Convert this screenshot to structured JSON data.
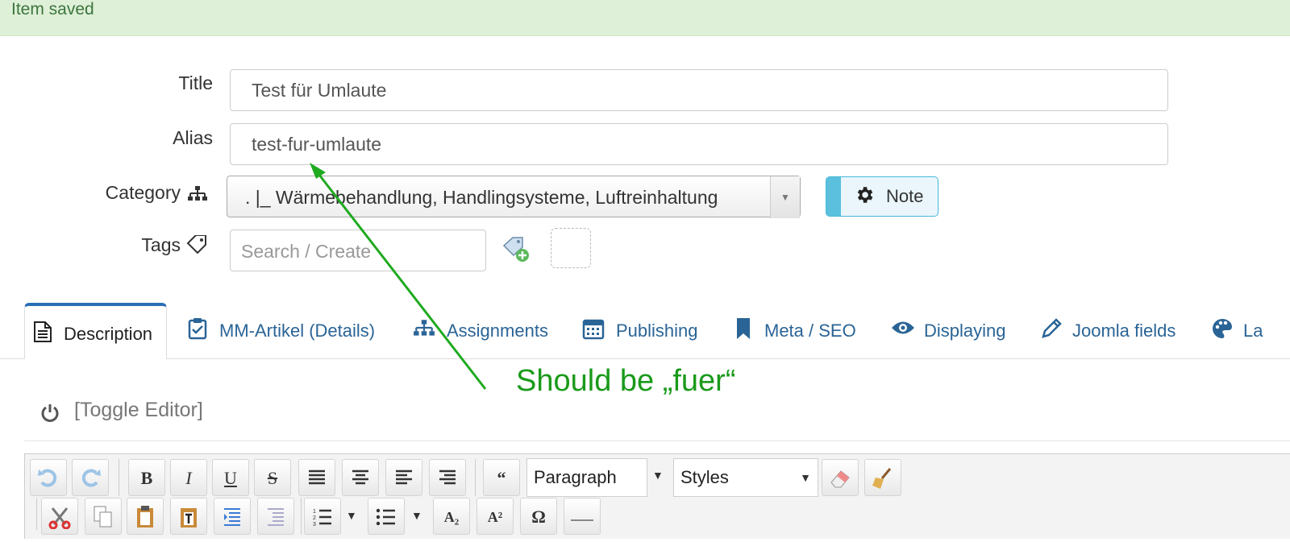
{
  "alert": {
    "message": "Item saved"
  },
  "form": {
    "title_label": "Title",
    "title_value": "Test für Umlaute",
    "alias_label": "Alias",
    "alias_value": "test-fur-umlaute",
    "category_label": "Category",
    "category_value": ". |_ Wärmebehandlung, Handlingsysteme, Luftreinhaltung",
    "note_label": "Note",
    "tags_label": "Tags",
    "tags_placeholder": "Search / Create"
  },
  "tabs": [
    {
      "label": "Description",
      "icon": "document-icon",
      "active": true
    },
    {
      "label": "MM-Artikel (Details)",
      "icon": "clipboard-check-icon"
    },
    {
      "label": "Assignments",
      "icon": "sitemap-icon"
    },
    {
      "label": "Publishing",
      "icon": "calendar-icon"
    },
    {
      "label": "Meta / SEO",
      "icon": "bookmark-icon"
    },
    {
      "label": "Displaying",
      "icon": "eye-icon"
    },
    {
      "label": "Joomla fields",
      "icon": "pencil-icon"
    },
    {
      "label": "La",
      "icon": "palette-icon"
    }
  ],
  "editor": {
    "toggle_label": "[Toggle Editor]",
    "format_select": "Paragraph",
    "styles_select": "Styles",
    "btn_bold": "B",
    "btn_italic": "I",
    "btn_underline": "U",
    "btn_strike": "S",
    "btn_quote": "“",
    "btn_subscript": "A₂",
    "btn_superscript": "A²",
    "btn_omega": "Ω"
  },
  "annotation": {
    "text": "Should be „fuer“",
    "color": "#1a9a1a"
  },
  "colors": {
    "accent": "#2a6496",
    "success_bg": "#dff0d8",
    "note": "#5bc0de"
  }
}
